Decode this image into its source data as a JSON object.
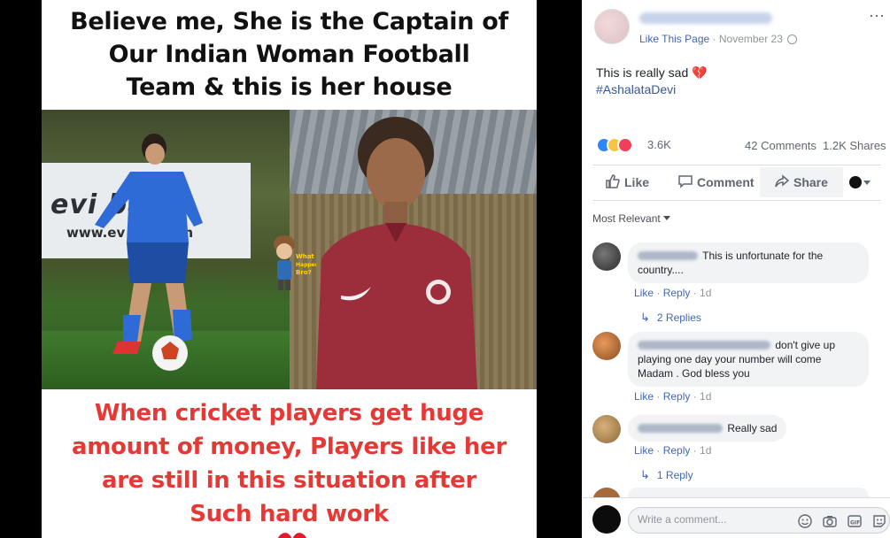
{
  "image": {
    "top_caption": [
      "Believe me, She is the Captain of",
      "Our Indian Woman Football",
      "Team & this is her house"
    ],
    "bottom_caption": [
      "When cricket players get huge",
      "amount of money, Players like her",
      "are still in this situation after",
      "Such hard work"
    ],
    "banner_text": "evi   ball",
    "banner_sub": "www.ev    ball.com",
    "watermark": "What Happened Bro?"
  },
  "post": {
    "page_meta": {
      "like_link": "Like This Page",
      "date": "November 23"
    },
    "text_line1": "This is really sad",
    "text_emoji": "💔",
    "hashtag": "#AshalataDevi",
    "reactions_count": "3.6K",
    "comments_count": "42 Comments",
    "shares_count": "1.2K Shares",
    "actions": {
      "like": "Like",
      "comment": "Comment",
      "share": "Share"
    }
  },
  "comments": {
    "sort_label": "Most Relevant",
    "items": [
      {
        "text": "This is unfortunate for the country....",
        "like": "Like",
        "reply": "Reply",
        "age": "1d",
        "replies": "2 Replies"
      },
      {
        "text": "don't give up playing one day your number will come Madam . God bless you",
        "like": "Like",
        "reply": "Reply",
        "age": "1d"
      },
      {
        "text": "Really sad",
        "like": "Like",
        "reply": "Reply",
        "age": "1d",
        "replies": "1 Reply"
      }
    ],
    "composer_placeholder": "Write a comment..."
  },
  "colors": {
    "fb_blue": "#4267b2",
    "meme_red": "#e53935",
    "text_dark": "#1d2129",
    "meta_gray": "#90949c"
  }
}
